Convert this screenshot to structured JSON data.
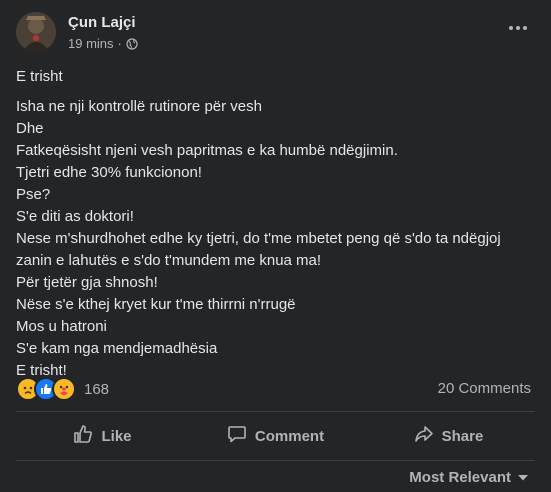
{
  "post": {
    "author": "Çun Lajçi",
    "time": "19 mins",
    "privacy_separator": "·",
    "title": "E trisht",
    "lines": [
      "Isha ne nji kontrollë rutinore për vesh",
      "Dhe",
      "Fatkeqësisht njeni vesh papritmas e ka humbë ndëgjimin.",
      "Tjetri edhe 30% funkcionon!",
      "Pse?",
      "S'e diti as doktori!",
      "Nese m'shurdhohet edhe ky tjetri, do t'me mbetet peng që s'do ta ndëgjoj zanin e lahutës e s'do t'mundem me knua ma!",
      "Për tjetër gja shnosh!",
      "Nëse s'e kthej kryet kur t'me thirrni n'rrugë",
      "Mos u hatroni",
      "S'e kam nga mendjemadhësia",
      "E trisht!"
    ]
  },
  "reactions": {
    "count": "168",
    "icons": [
      "sad-icon",
      "like-icon",
      "care-icon"
    ]
  },
  "comments_label": "20 Comments",
  "actions": {
    "like": "Like",
    "comment": "Comment",
    "share": "Share"
  },
  "sort_label": "Most Relevant",
  "colors": {
    "background": "#242526",
    "text": "#e4e6eb",
    "secondary": "#b0b3b8",
    "like_blue": "#1877f2",
    "sad_yellow": "#f7b928"
  }
}
